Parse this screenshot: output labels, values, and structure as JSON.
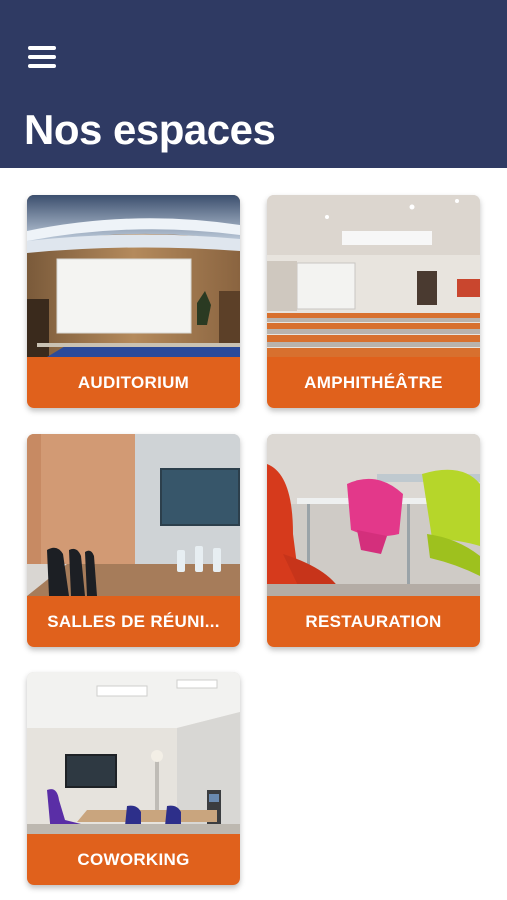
{
  "header": {
    "title": "Nos espaces",
    "menu_icon": "hamburger-menu-icon",
    "background": "#2f3a63"
  },
  "spaces": [
    {
      "label": "AUDITORIUM"
    },
    {
      "label": "AMPHITHÉÂTRE"
    },
    {
      "label": "SALLES DE RÉUNI..."
    },
    {
      "label": "RESTAURATION"
    },
    {
      "label": "COWORKING"
    }
  ],
  "colors": {
    "accent": "#e0611c",
    "header": "#2f3a63",
    "background": "#ffffff"
  }
}
